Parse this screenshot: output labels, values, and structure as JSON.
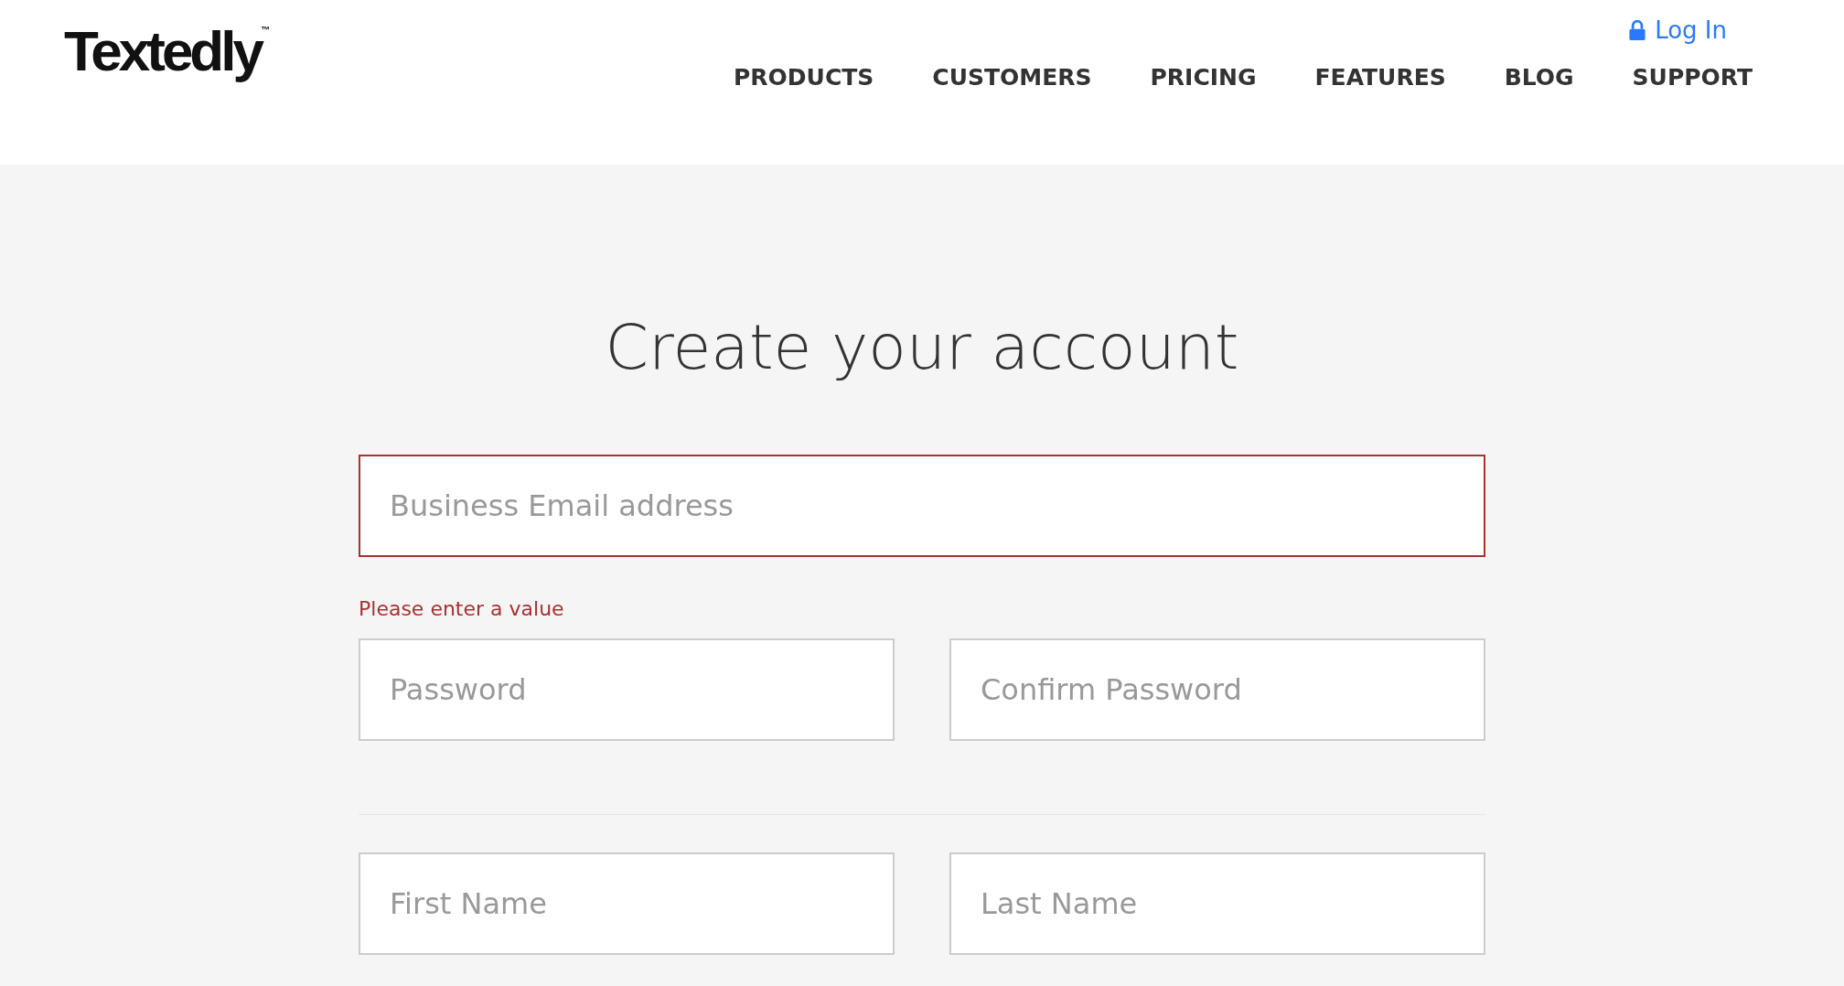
{
  "header": {
    "logo": "Textedly",
    "logo_mark": "™",
    "login": "Log In",
    "nav": [
      {
        "label": "PRODUCTS"
      },
      {
        "label": "CUSTOMERS"
      },
      {
        "label": "PRICING"
      },
      {
        "label": "FEATURES"
      },
      {
        "label": "BLOG"
      },
      {
        "label": "SUPPORT"
      }
    ]
  },
  "form": {
    "title": "Create your account",
    "email": {
      "placeholder": "Business Email address",
      "invalid": true,
      "error": "Please enter a value"
    },
    "password_row": [
      {
        "placeholder": "Password",
        "invalid": false
      },
      {
        "placeholder": "Confirm Password",
        "invalid": false
      }
    ],
    "name_row": [
      {
        "placeholder": "First Name",
        "invalid": false
      },
      {
        "placeholder": "Last Name",
        "invalid": false
      }
    ]
  }
}
